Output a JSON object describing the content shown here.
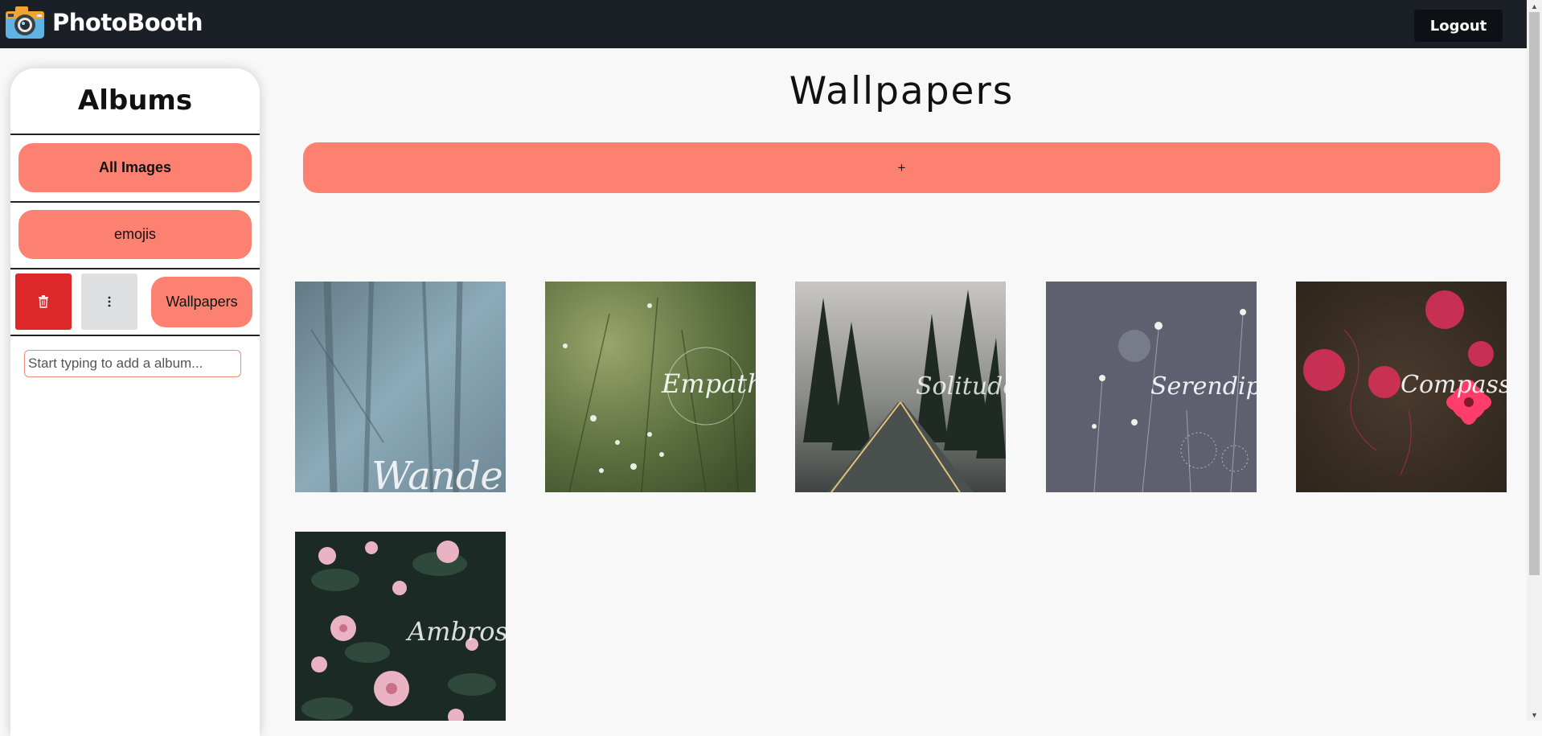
{
  "header": {
    "app_name": "PhotoBooth",
    "logo_icon": "camera-icon",
    "logout_label": "Logout"
  },
  "sidebar": {
    "title": "Albums",
    "albums": [
      {
        "label": "All Images"
      },
      {
        "label": "emojis"
      },
      {
        "label": "Wallpapers"
      }
    ],
    "delete_icon": "trash-icon",
    "more_icon": "more-vertical-icon",
    "new_album_placeholder": "Start typing to add a album..."
  },
  "main": {
    "title": "Wallpapers",
    "add_label": "+",
    "images": [
      {
        "caption": "Wanderlust",
        "theme": "foggy-forest"
      },
      {
        "caption": "Empathy",
        "theme": "green-meadow"
      },
      {
        "caption": "Solitude",
        "theme": "pine-road"
      },
      {
        "caption": "Serendipity",
        "theme": "grey-dandelions"
      },
      {
        "caption": "Compassion",
        "theme": "red-flowers"
      },
      {
        "caption": "Ambrosia",
        "theme": "pink-blossoms"
      }
    ]
  },
  "colors": {
    "accent": "#fd8170",
    "header_bg": "#1b1f26",
    "danger": "#dc2828"
  }
}
